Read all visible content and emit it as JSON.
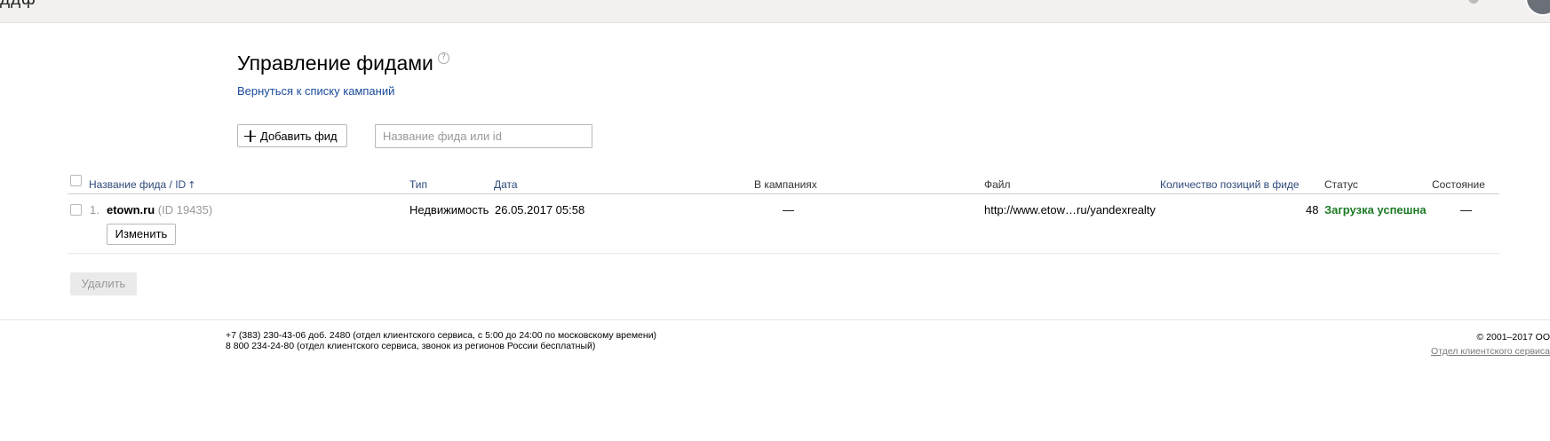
{
  "topbar": {
    "logo_fragment": "ддф"
  },
  "page": {
    "title": "Управление фидами",
    "help_symbol": "?",
    "back_link": "Вернуться к списку кампаний"
  },
  "toolbar": {
    "add_label": "Добавить фид",
    "search_placeholder": "Название фида или id"
  },
  "table": {
    "columns": {
      "name": "Название фида / ID",
      "sort_indicator": "↑",
      "type": "Тип",
      "date": "Дата",
      "campaigns": "В кампаниях",
      "file": "Файл",
      "count": "Количество позиций в фиде",
      "status": "Статус",
      "state": "Состояние"
    },
    "rows": [
      {
        "num": "1.",
        "name": "etown.ru",
        "id": "(ID 19435)",
        "type": "Недвижимость",
        "date": "26.05.2017 05:58",
        "campaigns": "—",
        "file": "http://www.etow…ru/yandexrealty",
        "count": "48",
        "status": "Загрузка успешна",
        "state": "—",
        "edit_label": "Изменить"
      }
    ],
    "delete_label": "Удалить"
  },
  "footer": {
    "phone_line_1": "+7 (383) 230-43-06 доб. 2480 (отдел клиентского сервиса, с 5:00 до 24:00 по московскому времени)",
    "phone_line_2": "8 800 234-24-80 (отдел клиентского сервиса, звонок из регионов России бесплатный)",
    "copyright": "© 2001–2017  ОО",
    "support_link": "Отдел клиентского сервиса"
  },
  "colors": {
    "link": "#1a4a9c",
    "status_success": "#1d7a26",
    "topbar_bg": "#f2f1ef"
  }
}
